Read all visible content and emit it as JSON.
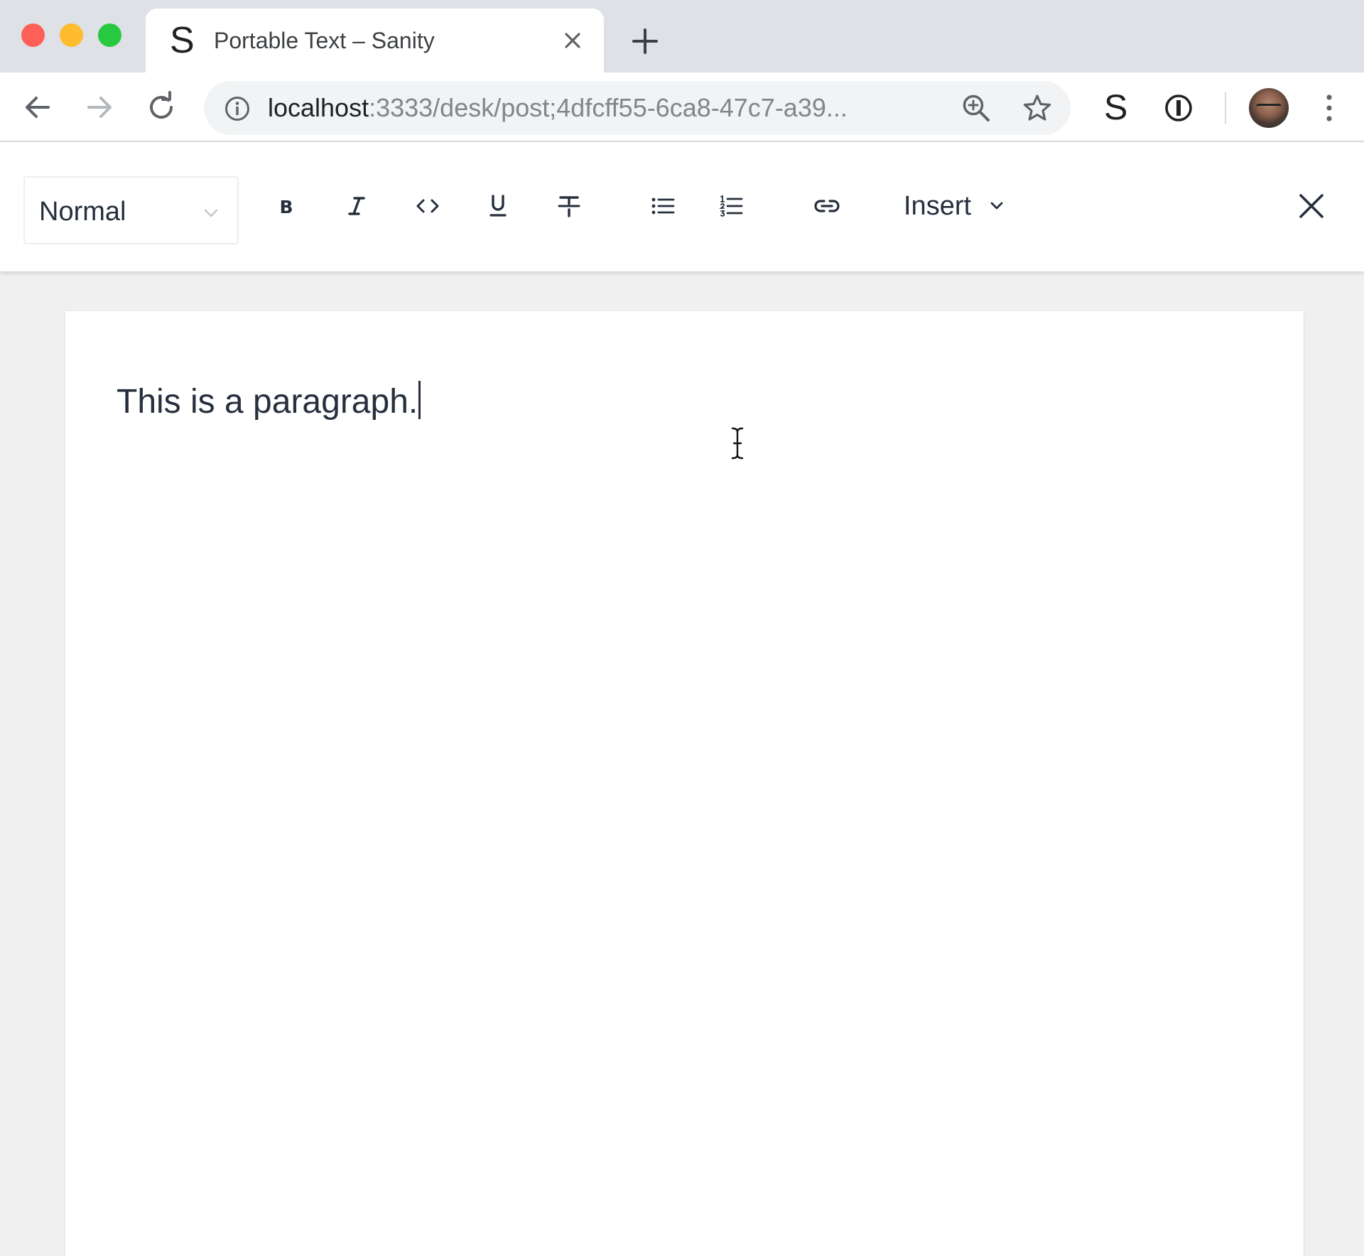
{
  "browser": {
    "tab": {
      "favicon": "S",
      "title": "Portable Text – Sanity",
      "close_icon": "close-icon"
    },
    "new_tab_icon": "plus-icon",
    "nav": {
      "back_icon": "arrow-left-icon",
      "forward_icon": "arrow-right-icon",
      "reload_icon": "reload-icon"
    },
    "address_bar": {
      "info_icon": "info-icon",
      "host": "localhost",
      "rest": ":3333/desk/post;4dfcff55-6ca8-47c7-a39...",
      "zoom_icon": "zoom-in-icon",
      "bookmark_icon": "star-icon"
    },
    "extensions": {
      "sanity": "S",
      "password_manager_icon": "password-manager-icon"
    },
    "profile_icon": "avatar",
    "menu_icon": "kebab-menu-icon",
    "colors": {
      "tabstrip": "#dee1e6",
      "close": "#fe5f57",
      "minimize": "#febc2e",
      "maximize": "#28c840"
    }
  },
  "editor": {
    "toolbar": {
      "block_style": "Normal",
      "decorators": [
        "bold-icon",
        "italic-icon",
        "code-icon",
        "underline-icon",
        "strikethrough-icon"
      ],
      "lists": [
        "bullet-list-icon",
        "numbered-list-icon"
      ],
      "annotation": "link-icon",
      "insert_label": "Insert",
      "close_icon": "close-icon"
    },
    "content": {
      "paragraph": "This is a paragraph."
    }
  }
}
